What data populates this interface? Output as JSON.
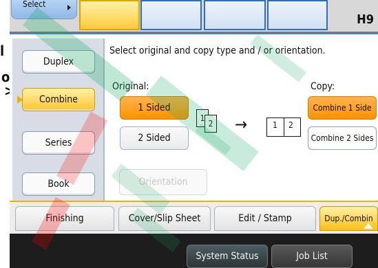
{
  "edge_text": {
    "a": "l",
    "b": "o",
    "c": ">"
  },
  "header": {
    "select_label": "Select",
    "code": "H9"
  },
  "modes": [
    {
      "label": "Duplex"
    },
    {
      "label": "Combine"
    },
    {
      "label": "Series"
    },
    {
      "label": "Book"
    }
  ],
  "main": {
    "prompt": "Select original and copy type and / or orientation.",
    "original_label": "Original:",
    "copy_label": "Copy:",
    "original_options": [
      {
        "label": "1 Sided"
      },
      {
        "label": "2 Sided"
      }
    ],
    "copy_options": [
      {
        "label": "Combine 1 Side"
      },
      {
        "label": "Combine 2 Sides"
      }
    ],
    "orientation_label": "Orientation",
    "diagram": {
      "page1": "1",
      "page2": "2",
      "arrow": "→",
      "combined_left": "1",
      "combined_right": "2"
    }
  },
  "tabs": [
    {
      "label": "Finishing"
    },
    {
      "label": "Cover/Slip Sheet"
    },
    {
      "label": "Edit / Stamp"
    },
    {
      "label": "Dup./Combin"
    }
  ],
  "bottom": {
    "system_status": "System Status",
    "job_list": "Job List"
  }
}
